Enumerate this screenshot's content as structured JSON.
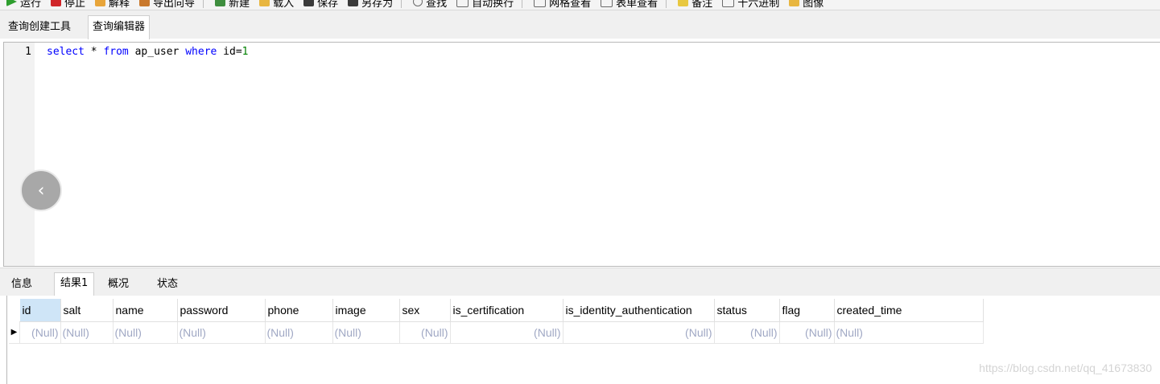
{
  "toolbar": {
    "items": [
      {
        "label": "运行",
        "icon": "run-icon",
        "color": "#2e9e2e"
      },
      {
        "label": "停止",
        "icon": "stop-icon",
        "color": "#d0262a"
      },
      {
        "label": "解释",
        "icon": "explain-icon",
        "color": "#e8a53a"
      },
      {
        "label": "导出向导",
        "icon": "export-wizard-icon",
        "color": "#c9792d"
      },
      {
        "label": "新建",
        "icon": "new-icon",
        "color": "#3f8e3f"
      },
      {
        "label": "载入",
        "icon": "load-icon",
        "color": "#e8b640"
      },
      {
        "label": "保存",
        "icon": "save-icon",
        "color": "#3a3a3a"
      },
      {
        "label": "另存为",
        "icon": "save-as-icon",
        "color": "#3a3a3a"
      },
      {
        "label": "查找",
        "icon": "find-icon",
        "color": "#6a6a6a"
      },
      {
        "label": "自动换行",
        "icon": "word-wrap-icon",
        "color": "#6a6a6a"
      },
      {
        "label": "网格查看",
        "icon": "grid-view-icon",
        "color": "#6a6a6a"
      },
      {
        "label": "表单查看",
        "icon": "form-view-icon",
        "color": "#6a6a6a"
      },
      {
        "label": "备注",
        "icon": "memo-icon",
        "color": "#e8c840"
      },
      {
        "label": "十六进制",
        "icon": "hex-icon",
        "color": "#6a6a6a"
      },
      {
        "label": "图像",
        "icon": "image-icon",
        "color": "#e8b640"
      }
    ]
  },
  "editor_tabs": {
    "builder": "查询创建工具",
    "editor": "查询编辑器"
  },
  "editor": {
    "line_number": "1",
    "tokens": {
      "select": "select",
      "star": " * ",
      "from": "from",
      "table": " ap_user ",
      "where": "where",
      "cond": " id=",
      "value": "1"
    },
    "nav_icon": "chevron-left-icon"
  },
  "result_tabs": {
    "info": "信息",
    "result1": "结果1",
    "profile": "概况",
    "status": "状态"
  },
  "grid": {
    "columns": [
      "id",
      "salt",
      "name",
      "password",
      "phone",
      "image",
      "sex",
      "is_certification",
      "is_identity_authentication",
      "status",
      "flag",
      "created_time"
    ],
    "row": [
      "(Null)",
      "(Null)",
      "(Null)",
      "(Null)",
      "(Null)",
      "(Null)",
      "(Null)",
      "(Null)",
      "(Null)",
      "(Null)",
      "(Null)",
      "(Null)"
    ]
  },
  "watermark": "https://blog.csdn.net/qq_41673830"
}
